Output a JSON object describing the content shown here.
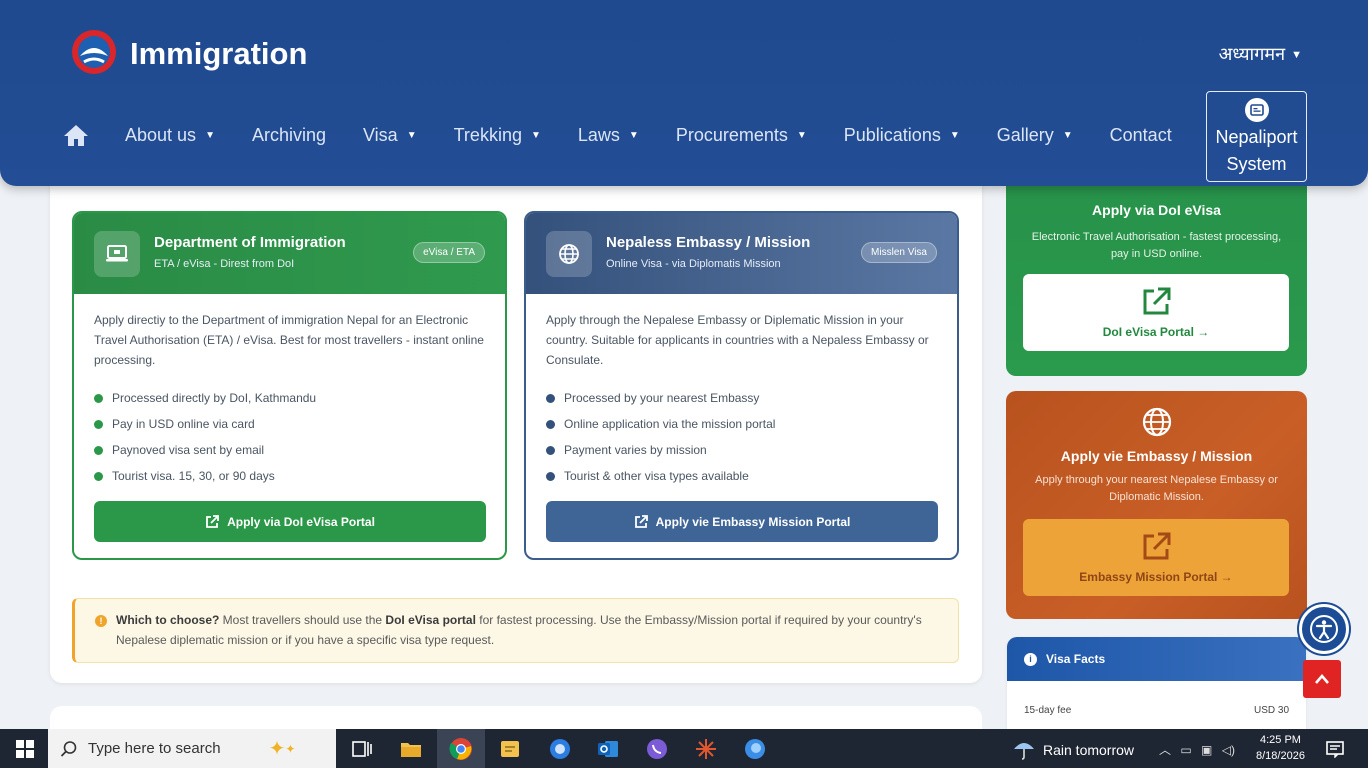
{
  "header": {
    "brand": "Immigration",
    "language": "अध्यागमन",
    "nav": [
      "About us",
      "Archiving",
      "Visa",
      "Trekking",
      "Laws",
      "Procurements",
      "Publications",
      "Gallery",
      "Contact"
    ],
    "nav_dropdown": [
      true,
      false,
      true,
      true,
      true,
      true,
      true,
      true,
      false
    ],
    "nepaliport_line1": "Nepaliport",
    "nepaliport_line2": "System"
  },
  "option_doi": {
    "title": "Department of Immigration",
    "subtitle": "ETA / eVisa - Direst from DoI",
    "badge": "eVisa / ETA",
    "description": "Apply directiy to the Department of immigration Nepal for an Electronic Travel Authorisation (ETA) / eVisa. Best for most travellers - instant online processing.",
    "points": [
      "Processed directly by DoI, Kathmandu",
      "Pay in USD online via card",
      "Paynoved visa sent by email",
      "Tourist visa. 15, 30, or 90 days"
    ],
    "button": "Apply via DoI eVisa Portal"
  },
  "option_embassy": {
    "title": "Nepaless Embassy / Mission",
    "subtitle": "Online Visa - via Diplomatis Mission",
    "badge": "Misslen Visa",
    "description": "Apply through the Nepalese Embassy or Diplematic Mission in your country. Suitable for applicants in countries with a Nepaless Embassy or Consulate.",
    "points": [
      "Processed by your nearest Embassy",
      "Online application via the mission portal",
      "Payment varies by mission",
      "Tourist & other visa types available"
    ],
    "button": "Apply vie Embassy Mission Portal"
  },
  "note": {
    "lead": "Which to choose?",
    "text1": " Most travellers should use the ",
    "bold": "DoI eVisa portal",
    "text2": " for fastest processing. Use the Embassy/Mission portal if required by your country's Nepalese diplematic mission or if you have a specific visa type request."
  },
  "side_evisa": {
    "title": "Apply via DoI eVisa",
    "description": "Electronic Travel Authorisation - fastest processing, pay in USD online.",
    "link": "DoI eVisa Portal →"
  },
  "side_embassy": {
    "title": "Apply vie Embassy / Mission",
    "description": "Apply through your nearest Nepalese Embassy or Diplomatic Mission.",
    "link": "Embassy Mission Portal →"
  },
  "visa_facts": {
    "title": "Visa Facts",
    "row_label": "15-day fee",
    "row_value": "USD 30"
  },
  "taskbar": {
    "search_placeholder": "Type here to search",
    "weather": "Rain tomorrow",
    "time": "4:25 PM",
    "date": "8/18/2026"
  },
  "colors": {
    "header": "#1f4a8f",
    "green": "#2a9848",
    "blue": "#3f6597",
    "orange": "#c95f27",
    "red": "#e02424"
  }
}
